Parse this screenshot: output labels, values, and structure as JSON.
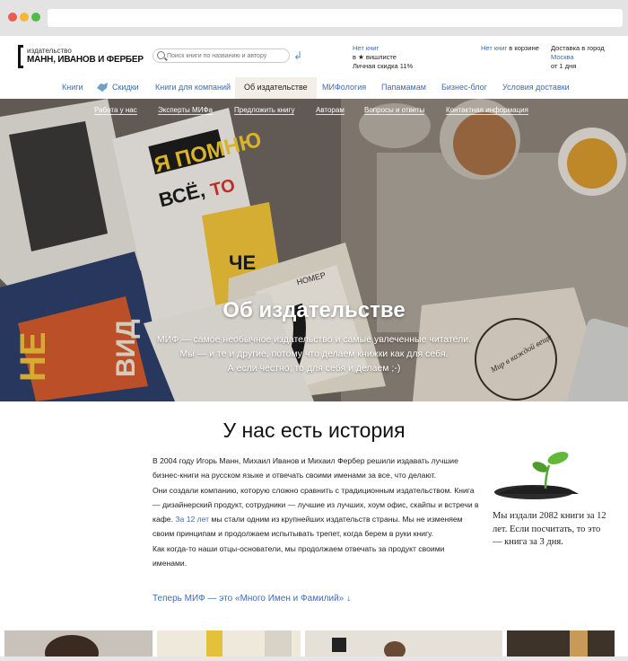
{
  "browser": {
    "dot_colors": [
      "#ee5a52",
      "#f5b731",
      "#4fbd43"
    ]
  },
  "logo": {
    "small": "издательство",
    "big": "МАНН, ИВАНОВ И ФЕРБЕР"
  },
  "search": {
    "placeholder": "Поиск книги по названию и автору"
  },
  "wishlist": {
    "link": "Нет книг",
    "line2": "в ★ вишлисте",
    "line3": "Личная скидка 11%"
  },
  "cart": {
    "link": "Нет книг",
    "text": " в корзине"
  },
  "delivery": {
    "line1": "Доставка в город",
    "city": "Москва",
    "line3": "от 1 дня"
  },
  "nav": {
    "items": [
      "Книги",
      "Скидки",
      "Книги для компаний",
      "Об издательстве",
      "МИФология",
      "Папамамам",
      "Бизнес-блог",
      "Условия доставки"
    ]
  },
  "subnav": {
    "items": [
      "Работа у нас",
      "Эксперты МИФа",
      "Предложить книгу",
      "Авторам",
      "Вопросы и ответы",
      "Контактная информация"
    ]
  },
  "hero": {
    "title": "Об издательстве",
    "line1": "МИФ — самое необычное издательство и самые увлеченные читатели.",
    "line2": "Мы — и те и другие, потому что делаем книжки как для себя.",
    "line3": "А если честно, то для себя и делаем ;-)",
    "book_text": {
      "a": "Я ПОМНЮ",
      "b": "ВСЁ,",
      "c": "ТО",
      "d": "ЧЕ",
      "e": "НОМЕР",
      "f": "НЕ",
      "g": "ВИД",
      "h": "Мир в каждой вещи"
    }
  },
  "history": {
    "title": "У нас есть история",
    "p1": "В 2004 году Игорь Манн, Михаил Иванов и Михаил Фербер решили издавать лучшие бизнес-книги на русском языке и отвечать своими именами за все, что делают.",
    "p2a": "Они создали компанию, которую сложно сравнить с традиционным издательством. Книга — дизайнерский продукт, сотрудники — лучшие из лучших, хоум офис, скайпы и встречи в кафе.",
    "p2link": "За 12 лет",
    "p2b": "мы стали одним из крупнейших издательств страны. Мы не изменяем своим принципам и продолжаем испытывать трепет, когда берем в руки книгу.",
    "p3": "Как когда-то наши отцы-основатели, мы продолжаем отвечать за продукт своими именами.",
    "more": "Теперь МИФ — это «Много Имен и Фамилий» ↓"
  },
  "stat": {
    "text": "Мы издали 2082 книги за 12 лет. Если посчитать, то это — книга за 3 дня."
  }
}
